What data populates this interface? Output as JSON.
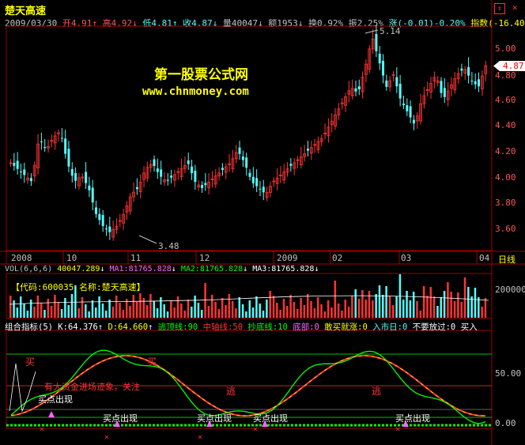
{
  "header": {
    "title": "楚天高速",
    "date": "2009/03/30",
    "open": "开4.91",
    "high": "高4.92",
    "low": "低4.81",
    "close": "收4.87",
    "volume": "量40047",
    "amount": "额1953",
    "turnover": "换0.92%",
    "amplitude": "振2.25%",
    "change": "涨(-0.01)-0.20%",
    "index_label": "指数(-16.40"
  },
  "watermark": {
    "line1": "第一股票公式网",
    "line2": "www.chnmoney.com"
  },
  "price_chart": {
    "y_ticks": [
      "5.00",
      "4.80",
      "4.60",
      "4.40",
      "4.20",
      "4.00",
      "3.80",
      "3.60"
    ],
    "current_price": "4.87",
    "high_label": "5.14",
    "low_label": "3.48"
  },
  "time_axis": {
    "labels": [
      "2008",
      "10",
      "11",
      "12",
      "2009",
      "02",
      "03",
      "04"
    ],
    "period": "日线"
  },
  "volume_panel": {
    "title": "VOL(6,6,6)",
    "vol": "40047.289",
    "ma1": "MA1:81765.828",
    "ma2": "MA2:81765.828",
    "ma3": "MA3:81765.828",
    "code_label": "【代码:600035 名称:楚天高速】",
    "y_tick": "200000"
  },
  "indicator_panel": {
    "title": "组合指标(5)",
    "k": "K:64.376",
    "d": "D:64.660",
    "escape_line": "逃顶线:90",
    "mid_line": "中轴线:50",
    "bottom_line": "抄底线:10",
    "bottom": "底部:0",
    "dare_buy": "敢买就涨:0",
    "entry_day": "入市日:0",
    "dont_miss": "不要放过:0",
    "buy_short": "买入",
    "y_ticks": [
      "50.00",
      "0.00"
    ],
    "annotations": {
      "buy1": "买",
      "buy2": "买",
      "escape1": "逃",
      "escape2": "逃",
      "big_money": "有大资金进场迹象，关注",
      "buy_point_1": "买点出现",
      "buy_point_2": "买点出现",
      "buy_point_3": "买点出现",
      "buy_point_4": "买点出现",
      "buy_point_5": "买点出现"
    }
  },
  "colors": {
    "up": "#ff3333",
    "down": "#54fcfc",
    "grid": "#a00000",
    "yellow": "#ffff00",
    "k_line": "#ffffff",
    "d_line": "#ffff00"
  },
  "chart_data": {
    "type": "line",
    "title": "",
    "price_range": [
      3.48,
      5.14
    ],
    "close_series_approx": [
      4.1,
      4.05,
      4.0,
      3.95,
      4.3,
      4.2,
      4.3,
      4.35,
      4.1,
      3.95,
      4.0,
      3.9,
      3.7,
      3.6,
      3.55,
      3.6,
      3.7,
      3.85,
      3.9,
      4.05,
      4.1,
      4.0,
      3.95,
      4.0,
      4.05,
      4.1,
      3.95,
      3.9,
      3.95,
      4.0,
      4.05,
      4.1,
      4.2,
      4.1,
      3.95,
      3.9,
      3.85,
      3.95,
      4.0,
      4.05,
      4.1,
      4.15,
      4.2,
      4.25,
      4.3,
      4.4,
      4.5,
      4.6,
      4.7,
      4.65,
      4.85,
      5.1,
      4.9,
      4.7,
      4.8,
      4.6,
      4.5,
      4.4,
      4.6,
      4.7,
      4.8,
      4.6,
      4.7,
      4.8,
      4.85,
      4.75,
      4.7,
      4.87
    ]
  }
}
